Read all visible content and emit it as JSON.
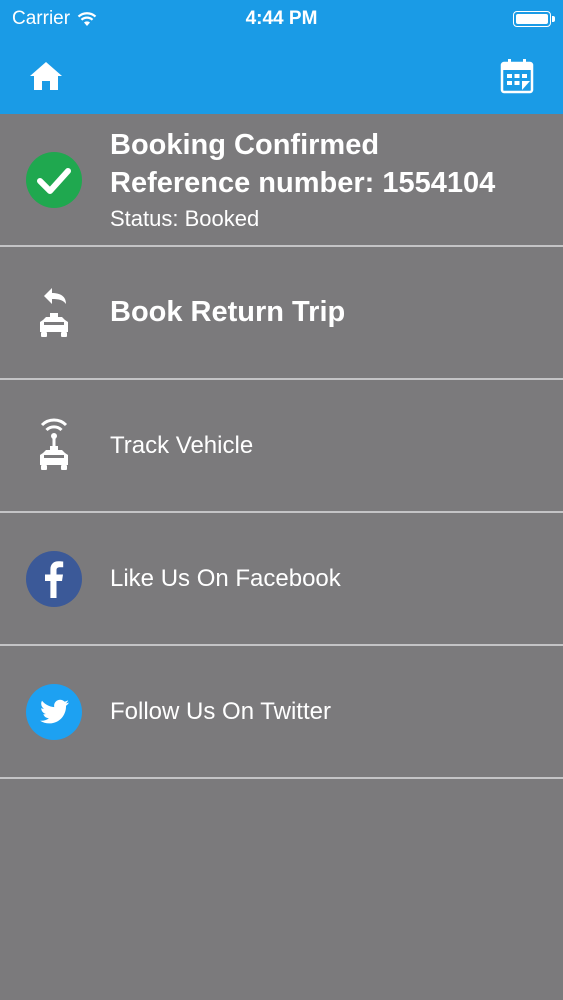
{
  "status_bar": {
    "carrier": "Carrier",
    "time": "4:44 PM"
  },
  "navbar": {
    "left_icon": "home-icon",
    "right_icon": "calendar-icon"
  },
  "booking": {
    "title": "Booking Confirmed",
    "reference": "Reference number: 1554104",
    "status": "Status: Booked"
  },
  "menu": [
    {
      "label": "Book Return Trip",
      "icon": "taxi-return-icon"
    },
    {
      "label": "Track Vehicle",
      "icon": "taxi-tracking-icon"
    },
    {
      "label": "Like Us On Facebook",
      "icon": "facebook-icon"
    },
    {
      "label": "Follow Us On Twitter",
      "icon": "twitter-icon"
    }
  ],
  "colors": {
    "header": "#1a9be6",
    "background": "#7b7a7c",
    "check_green": "#1fa84f",
    "facebook": "#3b5998",
    "twitter": "#1da1f2"
  }
}
